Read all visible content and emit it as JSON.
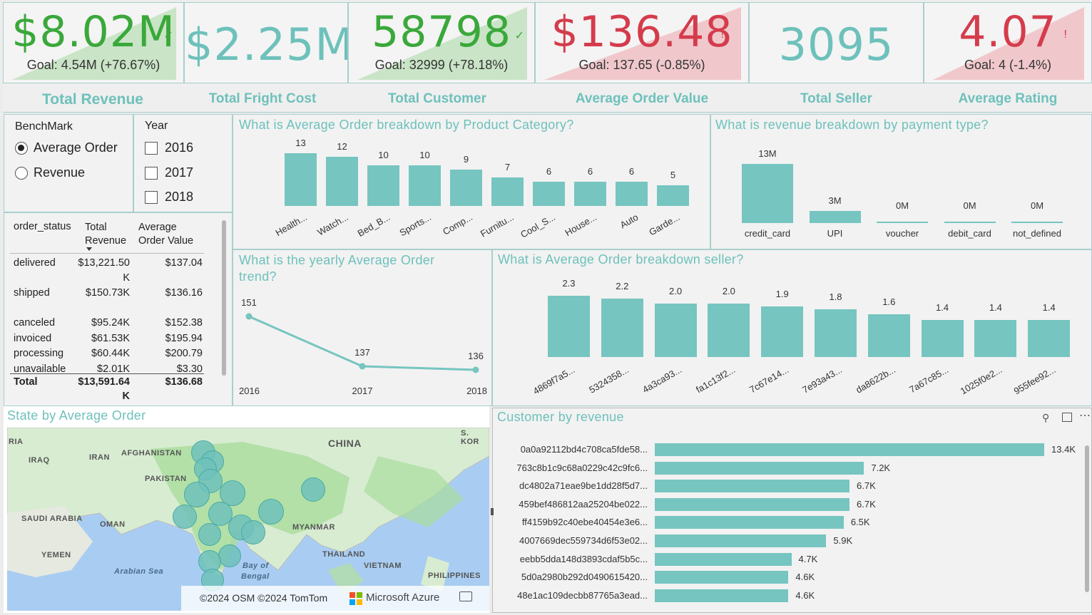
{
  "colors": {
    "accent": "#6ec1bb",
    "bar": "#76c5c0",
    "good": "#3aa83a",
    "bad": "#d43c4c",
    "neutral": "#6ec1bb"
  },
  "kpis": [
    {
      "value": "$8.02M",
      "goal": "Goal: 4.54M (+76.67%)",
      "status": "good",
      "title": "Total Revenue"
    },
    {
      "value": "$2.25M",
      "goal": "",
      "status": "neutral",
      "title": "Total Fright Cost"
    },
    {
      "value": "58798",
      "goal": "Goal: 32999 (+78.18%)",
      "status": "good",
      "title": "Total Customer"
    },
    {
      "value": "$136.48",
      "goal": "Goal: 137.65 (-0.85%)",
      "status": "bad",
      "title": "Average Order Value"
    },
    {
      "value": "3095",
      "goal": "",
      "status": "neutral",
      "title": "Total Seller"
    },
    {
      "value": "4.07",
      "goal": "Goal: 4 (-1.4%)",
      "status": "bad",
      "title": "Average Rating"
    }
  ],
  "benchmark": {
    "title": "BenchMark",
    "options": [
      "Average Order",
      "Revenue"
    ],
    "selected": "Average Order"
  },
  "year": {
    "title": "Year",
    "options": [
      "2016",
      "2017",
      "2018"
    ]
  },
  "status_table": {
    "headers": [
      "order_status",
      "Total Revenue",
      "Average Order Value"
    ],
    "rows": [
      [
        "delivered",
        "$13,221.50K",
        "$137.04"
      ],
      [
        "shipped",
        "$150.73K",
        "$136.16"
      ],
      [
        "canceled",
        "$95.24K",
        "$152.38"
      ],
      [
        "invoiced",
        "$61.53K",
        "$195.94"
      ],
      [
        "processing",
        "$60.44K",
        "$200.79"
      ],
      [
        "unavailable",
        "$2.01K",
        "$3.30"
      ]
    ],
    "total": [
      "Total",
      "$13,591.64K",
      "$136.68"
    ]
  },
  "panels": {
    "category_title": "What is Average Order breakdown by Product Category?",
    "payment_title": "What is revenue breakdown by payment type?",
    "trend_title": "What is the yearly Average Order trend?",
    "seller_title": "What is Average Order breakdown seller?",
    "map_title": "State by Average Order",
    "customer_title": "Customer by revenue"
  },
  "chart_data": [
    {
      "type": "bar",
      "title": "What is Average Order breakdown by Product Category?",
      "categories": [
        "Health...",
        "Watch...",
        "Bed_B...",
        "Sports...",
        "Comp...",
        "Furnitu...",
        "Cool_S...",
        "House...",
        "Auto",
        "Garde..."
      ],
      "values": [
        13,
        12,
        10,
        10,
        9,
        7,
        6,
        6,
        6,
        5
      ],
      "ylim": [
        0,
        14
      ]
    },
    {
      "type": "bar",
      "title": "What is revenue breakdown by payment type?",
      "categories": [
        "credit_card",
        "UPI",
        "voucher",
        "debit_card",
        "not_defined"
      ],
      "values": [
        12.5,
        2.5,
        0.3,
        0.2,
        0
      ],
      "labels": [
        "13M",
        "3M",
        "0M",
        "0M",
        "0M"
      ],
      "ylim": [
        0,
        13
      ]
    },
    {
      "type": "line",
      "title": "What is the yearly Average Order trend?",
      "x": [
        "2016",
        "2017",
        "2018"
      ],
      "values": [
        151,
        137,
        136
      ],
      "ylim": [
        135,
        152
      ]
    },
    {
      "type": "bar",
      "title": "What is Average Order breakdown seller?",
      "categories": [
        "4869f7a5...",
        "5324358...",
        "4a3ca93...",
        "fa1c13f2...",
        "7c67e14...",
        "7e93a43...",
        "da8622b...",
        "7a67c85...",
        "1025f0e2...",
        "955fee92..."
      ],
      "values": [
        2.3,
        2.2,
        2.0,
        2.0,
        1.9,
        1.8,
        1.6,
        1.4,
        1.4,
        1.4
      ],
      "labels": [
        "2.3",
        "2.2",
        "2.0",
        "2.0",
        "1.9",
        "1.8",
        "1.6",
        "1.4",
        "1.4",
        "1.4"
      ],
      "ylim": [
        0,
        2.4
      ]
    },
    {
      "type": "bar",
      "title": "Customer by revenue",
      "categories": [
        "0a0a92112bd4c708ca5fde58...",
        "763c8b1c9c68a0229c42c9fc6...",
        "dc4802a71eae9be1dd28f5d7...",
        "459bef486812aa25204be022...",
        "ff4159b92c40ebe40454e3e6...",
        "4007669dec559734d6f53e02...",
        "eebb5dda148d3893cdaf5b5c...",
        "5d0a2980b292d0490615420...",
        "48e1ac109decbb87765a3ead..."
      ],
      "values": [
        13.4,
        7.2,
        6.7,
        6.7,
        6.5,
        5.9,
        4.7,
        4.6,
        4.6
      ],
      "labels": [
        "13.4K",
        "7.2K",
        "6.7K",
        "6.7K",
        "6.5K",
        "5.9K",
        "4.7K",
        "4.6K",
        "4.6K"
      ],
      "xlim": [
        0,
        13.4
      ]
    }
  ],
  "map": {
    "labels": [
      "RIA",
      "IRAQ",
      "IRAN",
      "AFGHANISTAN",
      "PAKISTAN",
      "CHINA",
      "S. KOR",
      "SAUDI ARABIA",
      "OMAN",
      "YEMEN",
      "Arabian Sea",
      "MYANMAR",
      "THAILAND",
      "VIETNAM",
      "PHILIPPINES",
      "Bay of",
      "Bengal"
    ],
    "attribution": "©2024 OSM  ©2024 TomTom",
    "brand": "Microsoft Azure"
  }
}
